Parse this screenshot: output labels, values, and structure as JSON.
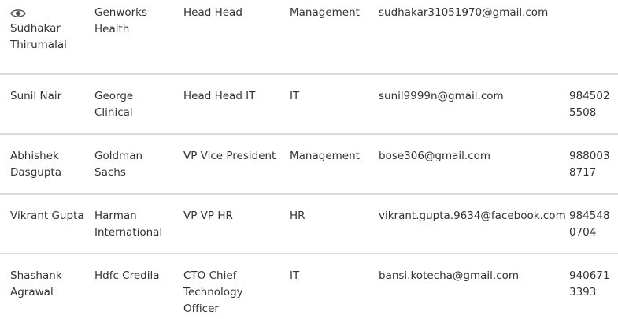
{
  "contacts": [
    {
      "name": "Sudhakar Thirumalai",
      "company": "Genworks Health",
      "title": "Head Head",
      "department": "Management",
      "email": "sudhakar31051970@gmail.com",
      "phone": "",
      "icon": "eye-icon"
    },
    {
      "name": "Sunil Nair",
      "company": "George Clinical",
      "title": "Head Head IT",
      "department": "IT",
      "email": "sunil9999n@gmail.com",
      "phone": "9845025508"
    },
    {
      "name": "Abhishek Dasgupta",
      "company": "Goldman Sachs",
      "title": "VP Vice President",
      "department": "Management",
      "email": "bose306@gmail.com",
      "phone": "9880038717"
    },
    {
      "name": "Vikrant Gupta",
      "company": "Harman International",
      "title": "VP VP HR",
      "department": "HR",
      "email": "vikrant.gupta.9634@facebook.com",
      "phone": "9845480704"
    },
    {
      "name": "Shashank Agrawal",
      "company": "Hdfc Credila",
      "title": "CTO Chief Technology Officer",
      "department": "IT",
      "email": "bansi.kotecha@gmail.com",
      "phone": "9406713393"
    }
  ]
}
